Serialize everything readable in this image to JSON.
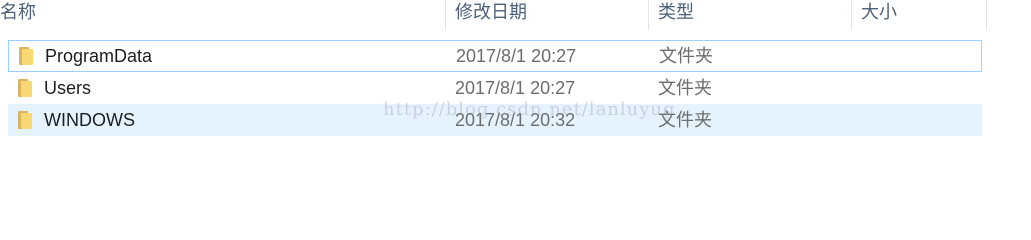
{
  "columns": {
    "name": "名称",
    "date": "修改日期",
    "type": "类型",
    "size": "大小"
  },
  "rows": [
    {
      "name": "ProgramData",
      "date": "2017/8/1 20:27",
      "type": "文件夹",
      "icon": "folder-icon",
      "state": "focused"
    },
    {
      "name": "Users",
      "date": "2017/8/1 20:27",
      "type": "文件夹",
      "icon": "folder-icon",
      "state": "normal"
    },
    {
      "name": "WINDOWS",
      "date": "2017/8/1 20:32",
      "type": "文件夹",
      "icon": "folder-icon",
      "state": "selected"
    }
  ],
  "watermark": "http://blog.csdn.net/lanluyug",
  "colors": {
    "header_text": "#4c607a",
    "selected_bg": "#e5f3ff",
    "focus_border": "#99d1ff",
    "folder_light": "#f8d775",
    "folder_dark": "#dcb55a"
  }
}
